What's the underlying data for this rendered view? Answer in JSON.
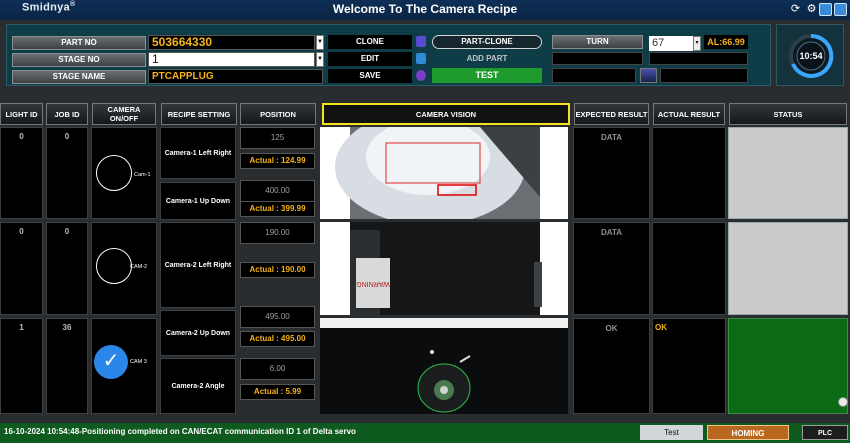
{
  "window": {
    "brand": "Smidnya",
    "brand_mark": "®",
    "title": "Welcome To The Camera Recipe"
  },
  "form": {
    "part_no_label": "PART NO",
    "part_no_value": "503664330",
    "stage_no_label": "STAGE NO",
    "stage_no_value": "1",
    "stage_name_label": "STAGE NAME",
    "stage_name_value": "PTCAPPLUG"
  },
  "actions": {
    "clone": "CLONE",
    "edit": "EDIT",
    "save": "SAVE",
    "part_clone": "PART-CLONE",
    "add_part": "ADD PART",
    "test": "TEST",
    "turn": "TURN",
    "turn_value": "67",
    "al_value": "AL:66.99"
  },
  "clock": {
    "time": "10:54"
  },
  "headers": {
    "light_id": "LIGHT ID",
    "job_id": "JOB ID",
    "camera_onoff": "CAMERA ON/OFF",
    "recipe_setting": "RECIPE SETTING",
    "position": "POSITION",
    "camera_vision": "CAMERA VISION",
    "expected_result": "EXPECTED RESULT",
    "actual_result": "ACTUAL RESULT",
    "status": "STATUS"
  },
  "rows": [
    {
      "light_id": "0",
      "job_id": "0",
      "camera": "Cam-1",
      "expected": "DATA",
      "actual": ""
    },
    {
      "light_id": "0",
      "job_id": "0",
      "camera": "CAM-2",
      "expected": "DATA",
      "actual": ""
    },
    {
      "light_id": "1",
      "job_id": "36",
      "camera": "CAM 3",
      "expected": "OK",
      "actual": "OK"
    }
  ],
  "recipes": [
    {
      "name": "Camera-1 Left Right",
      "set": "125",
      "actual": "Actual : 124.99"
    },
    {
      "name": "Camera-1 Up Down",
      "set": "400.00",
      "actual": "Actual : 399.99"
    },
    {
      "name": "Camera-2 Left Right",
      "set": "190.00",
      "actual": "Actual : 190.00"
    },
    {
      "name": "Camera-2 Up Down",
      "set": "495.00",
      "actual": "Actual : 495.00"
    },
    {
      "name": "Camera-2 Angle",
      "set": "6.00",
      "actual": "Actual : 5.99"
    }
  ],
  "colors": {
    "accent": "#f6b21b",
    "status_ok": "#0a6b14",
    "status_idle": "#c9cbcd",
    "vision_border": "#f4e21c"
  },
  "status_bar": {
    "message": "16-10-2024 10:54:48-Positioning completed on CAN/ECAT communication ID 1 of Delta servo",
    "test": "Test",
    "homing": "HOMING",
    "plc": "PLC"
  },
  "vision_text": {
    "warning": "WARNING"
  }
}
